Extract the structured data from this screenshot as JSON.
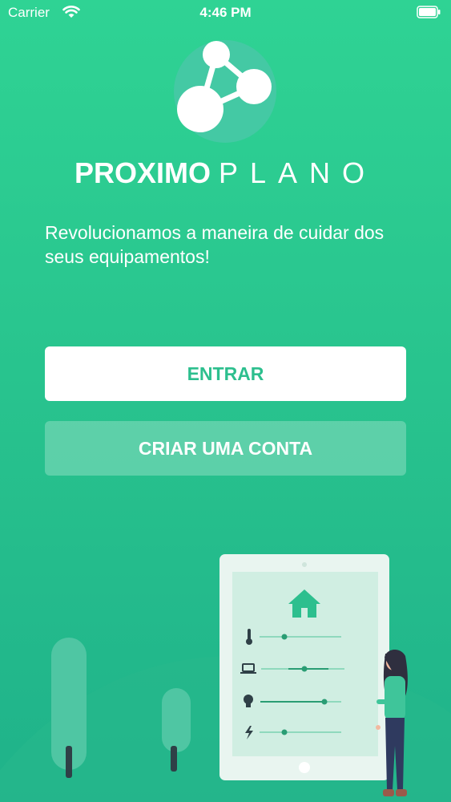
{
  "status_bar": {
    "carrier": "Carrier",
    "time": "4:46 PM"
  },
  "brand": {
    "part1": "PROXIMO",
    "part2": "PLANO"
  },
  "tagline": "Revolucionamos a maneira de cuidar dos seus equipamentos!",
  "buttons": {
    "enter": "ENTRAR",
    "create": "CRIAR UMA CONTA"
  },
  "colors": {
    "bg_top": "#2fd394",
    "bg_bottom": "#1fb28a",
    "accent": "#2dbf8e"
  },
  "illustration": {
    "icons": [
      "home-icon",
      "thermometer-icon",
      "laptop-icon",
      "lightbulb-icon",
      "bolt-icon"
    ],
    "slider_levels": [
      0.25,
      0.5,
      0.8,
      0.25
    ]
  }
}
